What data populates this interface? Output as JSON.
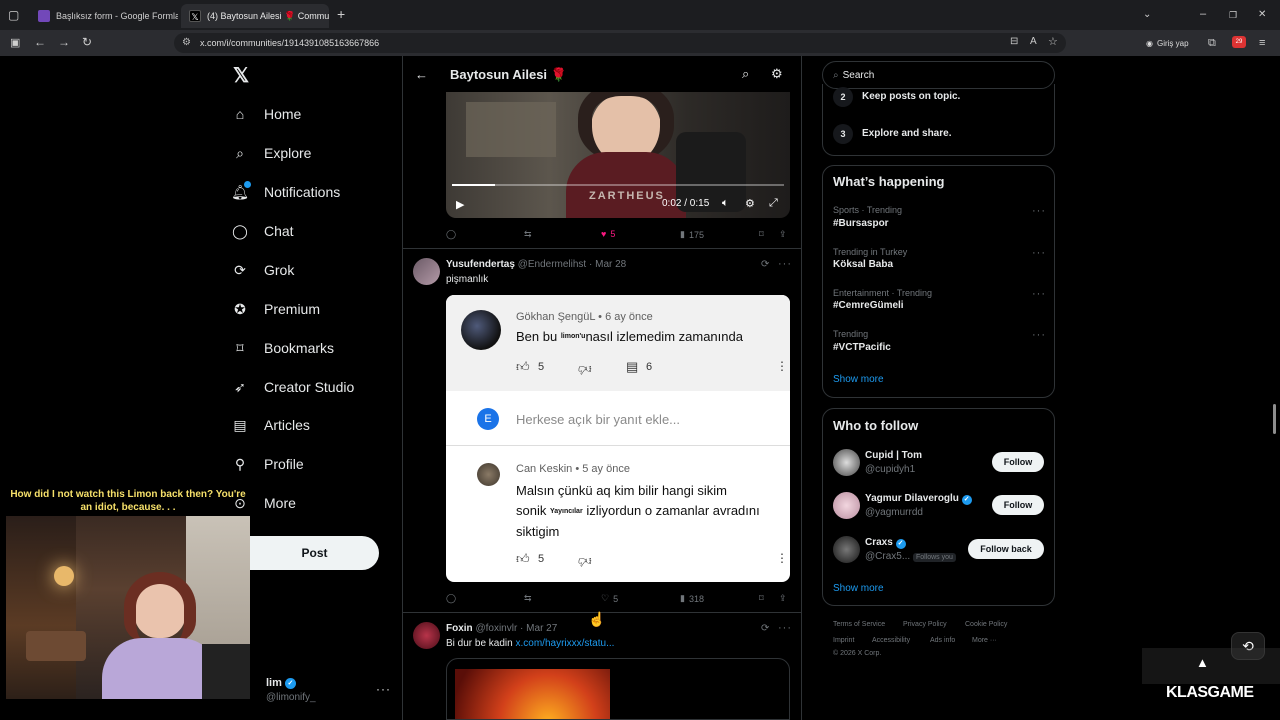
{
  "browser": {
    "tabs": [
      {
        "title": "Başlıksız form - Google Formlar",
        "active": false
      },
      {
        "title": "(4) Baytosun Ailesi 🌹 Communi",
        "active": true
      }
    ],
    "url": "x.com/i/communities/1914391085163667866",
    "profile_label": "Giriş yap",
    "ext_badge": "29"
  },
  "nav": {
    "items": [
      {
        "label": "Home",
        "icon": "home-icon"
      },
      {
        "label": "Explore",
        "icon": "search-icon"
      },
      {
        "label": "Notifications",
        "icon": "bell-icon"
      },
      {
        "label": "Chat",
        "icon": "chat-icon"
      },
      {
        "label": "Grok",
        "icon": "grok-icon"
      },
      {
        "label": "Premium",
        "icon": "verified-icon"
      },
      {
        "label": "Bookmarks",
        "icon": "bookmark-icon"
      },
      {
        "label": "Creator Studio",
        "icon": "rocket-icon"
      },
      {
        "label": "Articles",
        "icon": "article-icon"
      },
      {
        "label": "Profile",
        "icon": "person-icon"
      },
      {
        "label": "More",
        "icon": "more-circle-icon"
      }
    ],
    "post_label": "Post",
    "account": {
      "name": "lim",
      "handle": "@limonify_"
    }
  },
  "overlay": {
    "caption": "How did I not watch this Limon back then? You're an idiot, because. . ."
  },
  "header": {
    "title": "Baytosun Ailesi 🌹"
  },
  "video": {
    "time": "0:02 / 0:15",
    "watermark": "ZARTHEUS",
    "progress": 0.13
  },
  "tweets": [
    {
      "actions": {
        "replies": "",
        "retweets": "",
        "likes": "5",
        "views": "175"
      },
      "liked": true
    },
    {
      "name": "Yusufendertaş",
      "handle": "@Endermelihst",
      "date": "Mar 28",
      "text": "pişmanlık",
      "embed": {
        "comments": [
          {
            "author": "Gökhan ŞengüL",
            "age": "6 ay önce",
            "text_a": "Ben bu",
            "inline": "limon'u",
            "text_b": "nasıl izlemedim zamanında",
            "likes": "5",
            "replies": "6"
          },
          {
            "author": "Can Keskin",
            "age": "5 ay önce",
            "text_a": "Malsın çünkü aq kim bilir hangi sikim",
            "text_b": "sonik",
            "inline": "Yayıncılar",
            "text_c": "izliyordun o zamanlar avradını",
            "text_d": "siktigim",
            "likes": "5"
          }
        ],
        "reply_avatar": "E",
        "reply_placeholder": "Herkese açık bir yanıt ekle..."
      },
      "actions": {
        "replies": "",
        "retweets": "",
        "likes": "5",
        "views": "318"
      }
    },
    {
      "name": "Foxin",
      "handle": "@foxinvlr",
      "date": "Mar 27",
      "text": "Bi dur be kadin",
      "link": "x.com/hayrixxx/statu..."
    }
  ],
  "right": {
    "search_placeholder": "Search",
    "rules": [
      {
        "num": "2",
        "text": "Keep posts on topic."
      },
      {
        "num": "3",
        "text": "Explore and share."
      }
    ],
    "happening_title": "What’s happening",
    "trends": [
      {
        "context": "Sports · Trending",
        "name": "#Bursaspor"
      },
      {
        "context": "Trending in Turkey",
        "name": "Köksal Baba"
      },
      {
        "context": "Entertainment · Trending",
        "name": "#CemreGümeli"
      },
      {
        "context": "Trending",
        "name": "#VCTPacific"
      }
    ],
    "show_more": "Show more",
    "who_title": "Who to follow",
    "follow": [
      {
        "name": "Cupid | Tom",
        "handle": "@cupidyh1",
        "button": "Follow",
        "verified": false,
        "tag": ""
      },
      {
        "name": "Yagmur Dilaveroglu",
        "handle": "@yagmurrdd",
        "button": "Follow",
        "verified": true,
        "tag": ""
      },
      {
        "name": "Craxs",
        "handle": "@Crax5...",
        "button": "Follow back",
        "verified": true,
        "tag": "Follows you"
      }
    ],
    "footer": [
      "Terms of Service",
      "Privacy Policy",
      "Cookie Policy",
      "Imprint",
      "Accessibility",
      "Ads info",
      "More ···",
      "© 2026 X Corp."
    ]
  },
  "watermark_logo": "KLASGAME",
  "colors": {
    "accent": "#1d9bf0",
    "like": "#f91880",
    "bg": "#000000",
    "border": "#2f3336"
  }
}
